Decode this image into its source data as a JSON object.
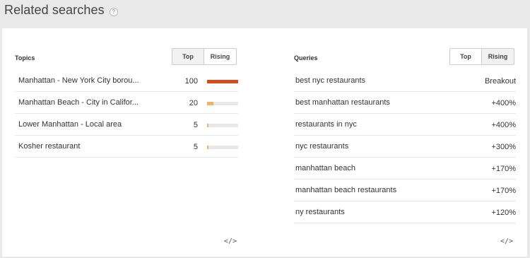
{
  "header": {
    "title": "Related searches",
    "help_icon": "?"
  },
  "topics": {
    "title": "Topics",
    "tabs": {
      "top": "Top",
      "rising": "Rising"
    },
    "bar_colors": {
      "high": "#d64a18",
      "low": "#f1b25c"
    },
    "rows": [
      {
        "label": "Manhattan - New York City borou...",
        "value": "100",
        "level": 1.0
      },
      {
        "label": "Manhattan Beach - City in Califor...",
        "value": "20",
        "level": 0.2
      },
      {
        "label": "Lower Manhattan - Local area",
        "value": "5",
        "level": 0.05
      },
      {
        "label": "Kosher restaurant",
        "value": "5",
        "level": 0.05
      }
    ],
    "embed_icon": "</>"
  },
  "queries": {
    "title": "Queries",
    "tabs": {
      "top": "Top",
      "rising": "Rising"
    },
    "rows": [
      {
        "label": "best nyc restaurants",
        "value": "Breakout"
      },
      {
        "label": "best manhattan restaurants",
        "value": "+400%"
      },
      {
        "label": "restaurants in nyc",
        "value": "+400%"
      },
      {
        "label": "nyc restaurants",
        "value": "+300%"
      },
      {
        "label": "manhattan beach",
        "value": "+170%"
      },
      {
        "label": "manhattan beach restaurants",
        "value": "+170%"
      },
      {
        "label": "ny restaurants",
        "value": "+120%"
      }
    ],
    "embed_icon": "</>"
  }
}
